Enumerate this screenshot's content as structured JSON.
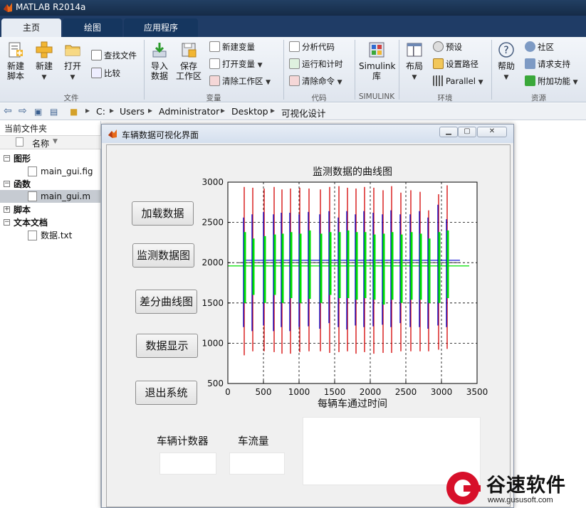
{
  "app": {
    "title": "MATLAB R2014a"
  },
  "tabs": [
    {
      "label": "主页",
      "active": true
    },
    {
      "label": "绘图",
      "active": false
    },
    {
      "label": "应用程序",
      "active": false
    }
  ],
  "ribbon": {
    "file_group": {
      "label": "文件",
      "new_script": "新建\n脚本",
      "new": "新建",
      "open": "打开",
      "find_files": "查找文件",
      "compare": "比较"
    },
    "variable_group": {
      "label": "变量",
      "import": "导入\n数据",
      "save_workspace": "保存\n工作区",
      "new_variable": "新建变量",
      "open_variable": "打开变量",
      "clear_workspace": "清除工作区"
    },
    "code_group": {
      "label": "代码",
      "analyze_code": "分析代码",
      "run_and_time": "运行和计时",
      "clear_commands": "清除命令"
    },
    "simulink_group": {
      "label": "SIMULINK",
      "library": "Simulink\n库"
    },
    "environment_group": {
      "label": "环境",
      "layout": "布局",
      "preferences": "预设",
      "set_path": "设置路径",
      "parallel": "Parallel"
    },
    "resources_group": {
      "label": "资源",
      "help": "帮助",
      "community": "社区",
      "request_support": "请求支持",
      "add_ons": "附加功能"
    }
  },
  "address_bar": {
    "path": [
      "C:",
      "Users",
      "Administrator",
      "Desktop",
      "可视化设计"
    ]
  },
  "current_folder": {
    "title": "当前文件夹",
    "column_name": "名称",
    "groups": [
      {
        "label": "图形",
        "expanded": true,
        "files": [
          {
            "name": "main_gui.fig",
            "selected": false
          }
        ]
      },
      {
        "label": "函数",
        "expanded": true,
        "files": [
          {
            "name": "main_gui.m",
            "selected": true
          }
        ]
      },
      {
        "label": "脚本",
        "expanded": false,
        "files": []
      },
      {
        "label": "文本文档",
        "expanded": true,
        "files": [
          {
            "name": "数据.txt",
            "selected": false
          }
        ]
      }
    ]
  },
  "figure_window": {
    "title": "车辆数据可视化界面",
    "buttons": {
      "load": "加载数据",
      "monitor_plot": "监测数据图",
      "diff_curve": "差分曲线图",
      "data_display": "数据显示",
      "exit": "退出系统"
    },
    "vehicle_counter_label": "车辆计数器",
    "traffic_flow_label": "车流量",
    "vehicle_counter_value": "",
    "traffic_flow_value": ""
  },
  "chart_data": {
    "type": "line",
    "title": "监测数据的曲线图",
    "xlabel": "每辆车通过时间",
    "ylabel": "",
    "xlim": [
      0,
      3500
    ],
    "ylim": [
      500,
      3000
    ],
    "xticks": [
      0,
      500,
      1000,
      1500,
      2000,
      2500,
      3000,
      3500
    ],
    "yticks": [
      500,
      1000,
      1500,
      2000,
      2500,
      3000
    ],
    "grid": "dashed",
    "baseline": 2000,
    "series_colors": {
      "series_1": "#d40000",
      "series_2": "#0000cc",
      "series_3": "#00e000"
    },
    "spikes": {
      "x": [
        230,
        350,
        510,
        650,
        760,
        880,
        1010,
        1140,
        1300,
        1430,
        1560,
        1680,
        1800,
        1920,
        2050,
        2180,
        2300,
        2430,
        2570,
        2700,
        2820,
        2960,
        3080
      ],
      "red_high": [
        2940,
        2930,
        2920,
        2940,
        2910,
        2920,
        2930,
        2920,
        2910,
        2940,
        2950,
        2930,
        2920,
        2940,
        2930,
        2900,
        2950,
        2870,
        2900,
        2880,
        2650,
        2850,
        2960
      ],
      "red_low": [
        850,
        900,
        900,
        890,
        870,
        870,
        890,
        900,
        900,
        880,
        890,
        900,
        870,
        890,
        870,
        880,
        880,
        900,
        900,
        900,
        900,
        920,
        930
      ],
      "blue_high": [
        2560,
        2600,
        2630,
        2600,
        2620,
        2620,
        2600,
        2630,
        2600,
        2640,
        2560,
        2640,
        2600,
        2640,
        2620,
        2600,
        2650,
        2600,
        2600,
        2640,
        2560,
        2720,
        2540
      ],
      "blue_low": [
        1200,
        1150,
        1220,
        1150,
        1200,
        1150,
        1200,
        1210,
        1180,
        1250,
        1200,
        1170,
        1220,
        1200,
        1210,
        1230,
        1200,
        1250,
        1200,
        1200,
        1180,
        1220,
        1200
      ],
      "green_high": [
        2380,
        2300,
        2330,
        2350,
        2360,
        2380,
        2360,
        2400,
        2360,
        2380,
        2380,
        2400,
        2380,
        2380,
        2350,
        2360,
        2380,
        2350,
        2380,
        2360,
        2300,
        2380,
        2400
      ],
      "green_low": [
        1500,
        1600,
        1500,
        1600,
        1500,
        1560,
        1500,
        1550,
        1500,
        1600,
        1560,
        1560,
        1540,
        1560,
        1540,
        1480,
        1540,
        1500,
        1540,
        1540,
        1500,
        1500,
        1560
      ]
    }
  },
  "watermark": {
    "brand": "谷速软件",
    "url": "www.gususoft.com"
  }
}
